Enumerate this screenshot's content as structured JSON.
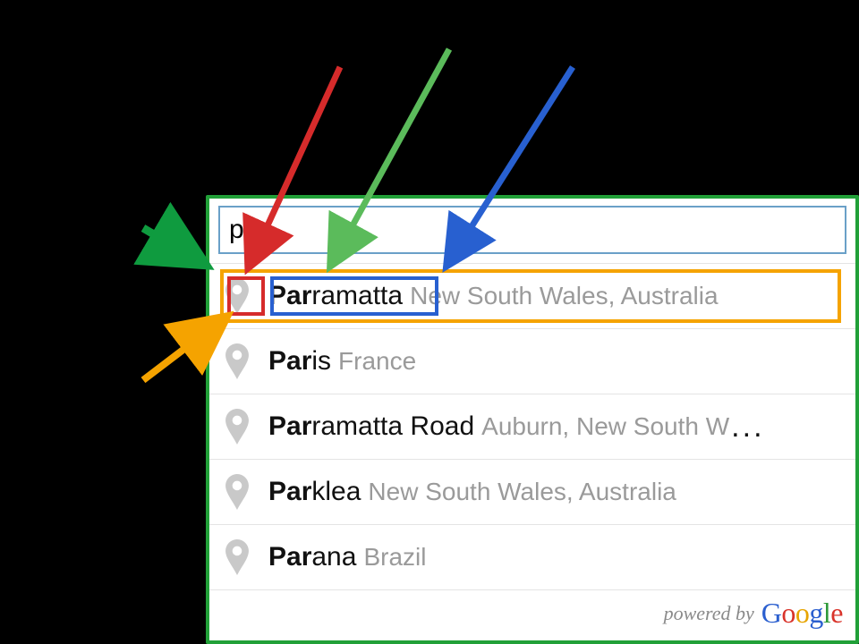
{
  "search": {
    "value": "par",
    "placeholder": ""
  },
  "suggestions": [
    {
      "match": "Par",
      "rest": "ramatta",
      "secondary": "New South Wales, Australia",
      "truncated": false
    },
    {
      "match": "Par",
      "rest": "is",
      "secondary": "France",
      "truncated": false
    },
    {
      "match": "Par",
      "rest": "ramatta Road",
      "secondary": "Auburn, New South W",
      "truncated": true
    },
    {
      "match": "Par",
      "rest": "klea",
      "secondary": "New South Wales, Australia",
      "truncated": false
    },
    {
      "match": "Par",
      "rest": "ana",
      "secondary": "Brazil",
      "truncated": false
    }
  ],
  "attribution": {
    "prefix": "powered by",
    "brand": "Google"
  },
  "annotation": {
    "highlights": [
      "orange-row-box",
      "red-icon-box",
      "blue-text-box"
    ],
    "arrows": [
      {
        "color": "#d62b2b",
        "target": "pin-icon-first"
      },
      {
        "color": "#5bbb5b",
        "target": "match-text-first"
      },
      {
        "color": "#2860d0",
        "target": "suggestion-text-first"
      },
      {
        "color": "#0f9b3f",
        "target": "suggestion-dropdown"
      },
      {
        "color": "#f5a300",
        "target": "suggestion-row-first"
      }
    ]
  }
}
